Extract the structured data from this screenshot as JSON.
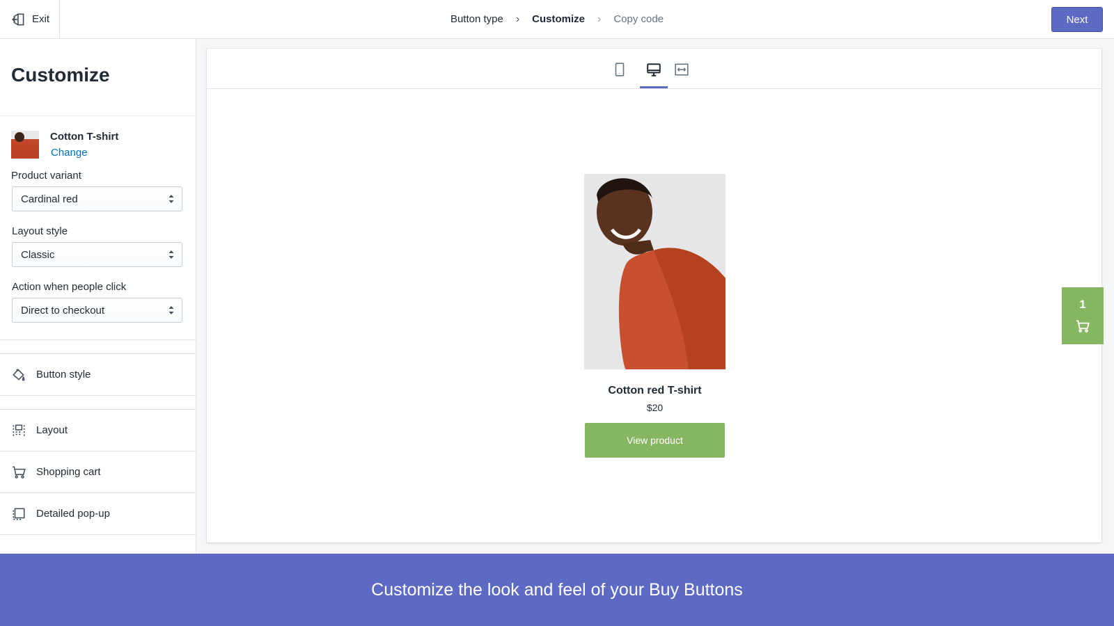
{
  "topbar": {
    "exit_label": "Exit",
    "steps": [
      {
        "label": "Button type"
      },
      {
        "label": "Customize"
      },
      {
        "label": "Copy code"
      }
    ],
    "next_label": "Next"
  },
  "sidebar": {
    "title": "Customize",
    "product": {
      "name": "Cotton T-shirt",
      "change_label": "Change"
    },
    "fields": [
      {
        "label": "Product variant",
        "value": "Cardinal red"
      },
      {
        "label": "Layout style",
        "value": "Classic"
      },
      {
        "label": "Action when people click",
        "value": "Direct to checkout"
      }
    ],
    "nav": [
      {
        "label": "Button style",
        "icon": "paint-bucket-icon"
      },
      {
        "label": "Layout",
        "icon": "layout-icon"
      },
      {
        "label": "Shopping cart",
        "icon": "cart-icon"
      },
      {
        "label": "Detailed pop-up",
        "icon": "popup-icon"
      }
    ]
  },
  "preview": {
    "view_tabs": [
      "mobile-view-icon",
      "desktop-view-icon",
      "full-width-view-icon"
    ],
    "active_view": "desktop",
    "product_title": "Cotton red T-shirt",
    "price": "$20",
    "button_label": "View product",
    "cart_count": "1",
    "accent_color": "#87b662"
  },
  "banner": {
    "text": "Customize the look and feel of your Buy Buttons"
  },
  "colors": {
    "primary": "#5c6ac4",
    "link": "#006fbb",
    "button_green": "#87b662"
  }
}
